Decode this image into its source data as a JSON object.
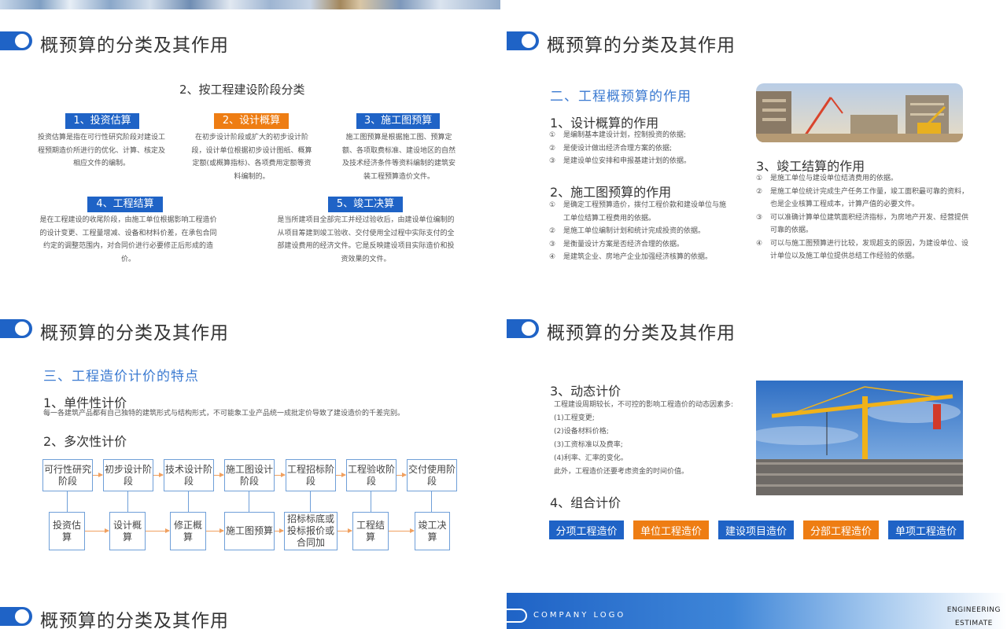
{
  "slide_title": "概预算的分类及其作用",
  "slide1": {
    "heading": "2、按工程建设阶段分类",
    "items": [
      {
        "label": "1、投资估算",
        "desc": "投资估算是指在可行性研究阶段对建设工程预期造价所进行的优化、计算、核定及相应文件的编制。"
      },
      {
        "label": "2、设计概算",
        "desc": "在初步设计阶段或扩大的初步设计阶段，设计单位根据初步设计图纸、概算定额(或概算指标)、各项费用定额等资料编制的。"
      },
      {
        "label": "3、施工图预算",
        "desc": "施工图预算是根据施工图、预算定额、各项取费标准、建设地区的自然及技术经济条件等资料编制的建筑安装工程预算造价文件。"
      },
      {
        "label": "4、工程结算",
        "desc": "是在工程建设的收尾阶段，由施工单位根据影响工程造价的设计变更、工程量增减、设备和材料价差，在承包合同约定的调整范围内，对合同价进行必要修正后形成的造价。"
      },
      {
        "label": "5、竣工决算",
        "desc": "是当所建项目全部完工并经过验收后，由建设单位编制的从项目筹建到竣工验收、交付使用全过程中实际支付的全部建设费用的经济文件。它是反映建设项目实际造价和投资效果的文件。"
      }
    ]
  },
  "slide2": {
    "section": "二、工程概预算的作用",
    "blocks": [
      {
        "title": "1、设计概算的作用",
        "items": [
          {
            "num": "①",
            "text": "是编制基本建设计划，控制投资的依据;"
          },
          {
            "num": "②",
            "text": "是使设计做出经济合理方案的依据;"
          },
          {
            "num": "③",
            "text": "是建设单位安排和申报基建计划的依据。"
          }
        ]
      },
      {
        "title": "2、施工图预算的作用",
        "items": [
          {
            "num": "①",
            "text": "是确定工程预算造价，拨付工程价款和建设单位与施工单位结算工程费用的依据。"
          },
          {
            "num": "②",
            "text": "是施工单位编制计划和统计完成投资的依据。"
          },
          {
            "num": "③",
            "text": "是衡量设计方案是否经济合理的依据。"
          },
          {
            "num": "④",
            "text": "是建筑企业、房地产企业加强经济核算的依据。"
          }
        ]
      },
      {
        "title": "3、竣工结算的作用",
        "items": [
          {
            "num": "①",
            "text": "是施工单位与建设单位结清费用的依据。"
          },
          {
            "num": "②",
            "text": "是施工单位统计完成生产任务工作量，竣工面积最可靠的资料，也是企业核算工程成本，计算产值的必要文件。"
          },
          {
            "num": "③",
            "text": "可以准确计算单位建筑面积经济指标，为房地产开发、经营提供可靠的依据。"
          },
          {
            "num": "④",
            "text": "可以与施工图预算进行比较，发现超支的原因，为建设单位、设计单位以及施工单位提供总结工作经验的依据。"
          }
        ]
      }
    ]
  },
  "slide3": {
    "section": "三、工程造价计价的特点",
    "h1": "1、单件性计价",
    "p1": "每一各建筑产品都有自己独特的建筑形式与结构形式，不可能象工业产品统一成批定价导致了建设造价的千差完别。",
    "h2": "2、多次性计价",
    "top_row": [
      "可行性研究阶段",
      "初步设计阶段",
      "技术设计阶段",
      "施工图设计阶段",
      "工程招标阶段",
      "工程验收阶段",
      "交付使用阶段"
    ],
    "bottom_row": [
      "投资估算",
      "设计概算",
      "修正概算",
      "施工图预算",
      "招标标底或投标报价或合同加",
      "工程结算",
      "竣工决算"
    ]
  },
  "slide4": {
    "h1": "3、动态计价",
    "lines": [
      "工程建设周期较长，不可控的影响工程造价的动态因素多:",
      "(1)工程变更;",
      "(2)设备材料价格;",
      "(3)工资标准以及费率;",
      "(4)利率、汇率的变化。",
      "此外，工程造价还要考虑资金的时间价值。"
    ],
    "h2": "4、组合计价",
    "buttons": [
      {
        "label": "分项工程造价",
        "color": "#1f63c6"
      },
      {
        "label": "单位工程造价",
        "color": "#ee7d13"
      },
      {
        "label": "建设项目造价",
        "color": "#1f63c6"
      },
      {
        "label": "分部工程造价",
        "color": "#ee7d13"
      },
      {
        "label": "单项工程造价",
        "color": "#1f63c6"
      }
    ]
  },
  "slide6": {
    "logo": "COMPANY LOGO",
    "right_line1": "ENGINEERING",
    "right_line2": "ESTIMATE"
  },
  "colors": {
    "primary": "#1f63c6",
    "accent": "#ee7d13",
    "section": "#3b7ad1"
  }
}
